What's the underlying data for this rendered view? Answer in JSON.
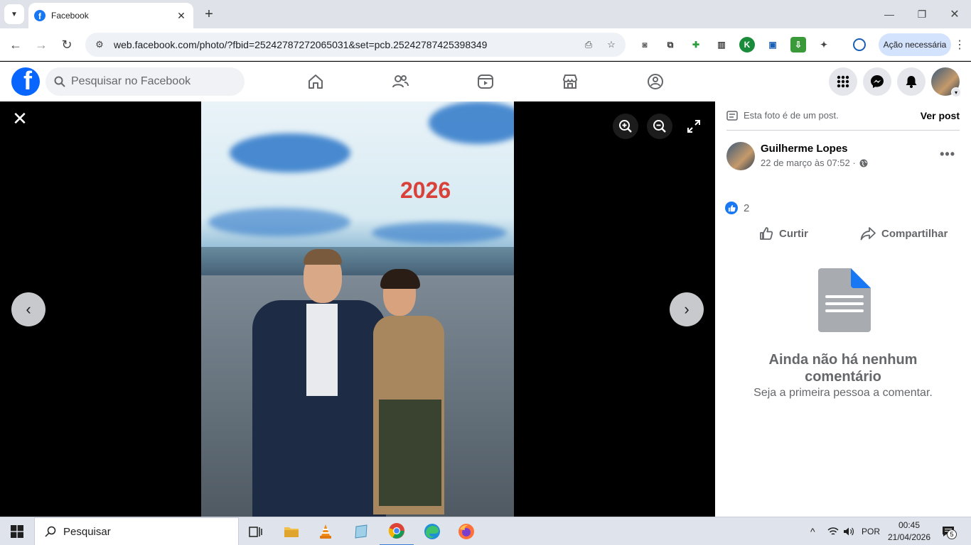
{
  "browser": {
    "tab_title": "Facebook",
    "url": "web.facebook.com/photo/?fbid=25242787272065031&set=pcb.25242787425398349",
    "action_label": "Ação necessária"
  },
  "header": {
    "search_placeholder": "Pesquisar no Facebook"
  },
  "photo": {
    "overlay_text": "2026"
  },
  "sidebar": {
    "post_note": "Esta foto é de um post.",
    "see_post": "Ver post",
    "author": "Guilherme Lopes",
    "date": "22 de março às 07:52 ·",
    "reaction_count": "2",
    "like_label": "Curtir",
    "share_label": "Compartilhar",
    "empty_title": "Ainda não há nenhum comentário",
    "empty_subtitle": "Seja a primeira pessoa a comentar."
  },
  "taskbar": {
    "search_label": "Pesquisar",
    "language": "POR",
    "time": "00:45",
    "date": "21/04/2026",
    "notification_count": "5"
  },
  "colors": {
    "facebook_blue": "#0866ff",
    "like_blue": "#1877f2",
    "overlay_red": "#d9423a"
  }
}
